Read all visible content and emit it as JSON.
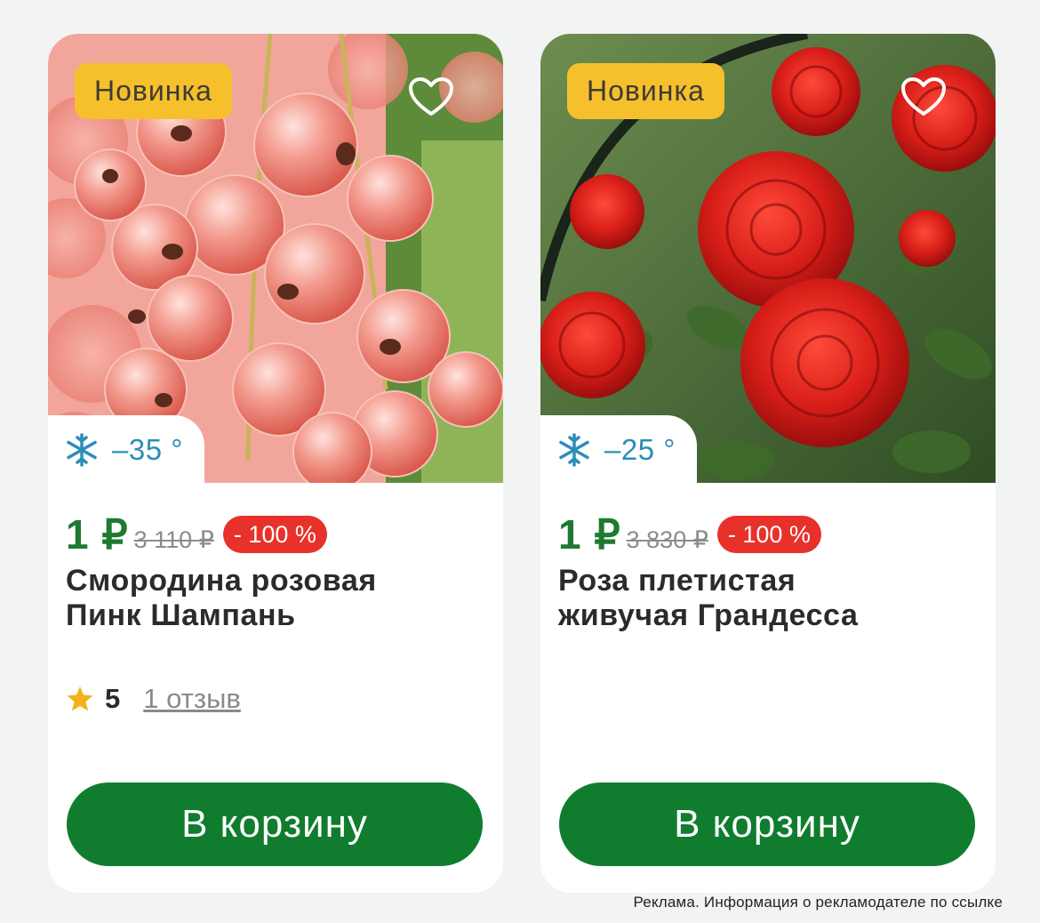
{
  "cards": [
    {
      "badge": "Новинка",
      "frost": "–35 °",
      "price_now": "1 ₽",
      "price_old": "3 110 ₽",
      "discount": "- 100 %",
      "title_lines": [
        "Смородина розовая",
        "Пинк Шампань"
      ],
      "rating": {
        "score": "5",
        "reviews": "1 отзыв"
      },
      "button": "В корзину"
    },
    {
      "badge": "Новинка",
      "frost": "–25 °",
      "price_now": "1 ₽",
      "price_old": "3 830 ₽",
      "discount": "- 100 %",
      "title_lines": [
        "Роза плетистая",
        "живучая Грандесса"
      ],
      "button": "В корзину"
    }
  ],
  "footer": {
    "ad_note": "Реклама. Информация о рекламодателе по ссылке"
  },
  "colors": {
    "badge_bg": "#f6c02c",
    "price_green": "#1f7a31",
    "discount_red": "#e8312a",
    "button_green": "#0f7c2e",
    "frost_blue": "#2d8db8"
  },
  "icons": [
    "heart-outline-icon",
    "snowflake-icon",
    "star-icon"
  ]
}
